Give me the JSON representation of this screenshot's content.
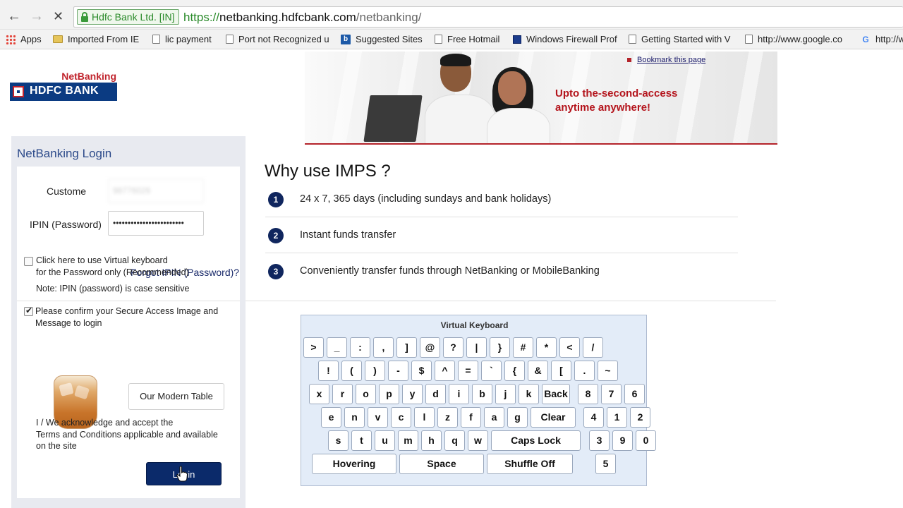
{
  "browser": {
    "ev_badge": "Hdfc Bank Ltd. [IN]",
    "url_scheme": "https://",
    "url_host": "netbanking.hdfcbank.com",
    "url_path": "/netbanking/",
    "back_icon": "←",
    "forward_icon": "→",
    "stop_icon": "✕"
  },
  "bookmarks": [
    {
      "label": "Apps",
      "icon": "apps-icon"
    },
    {
      "label": "Imported From IE",
      "icon": "folder-icon"
    },
    {
      "label": "lic payment",
      "icon": "page-icon"
    },
    {
      "label": "Port not Recognized u",
      "icon": "page-icon"
    },
    {
      "label": "Suggested Sites",
      "icon": "bing-icon"
    },
    {
      "label": "Free Hotmail",
      "icon": "page-icon"
    },
    {
      "label": "Windows Firewall Prof",
      "icon": "windows-icon"
    },
    {
      "label": "Getting Started with V",
      "icon": "page-icon"
    },
    {
      "label": "http://www.google.co",
      "icon": "page-icon"
    },
    {
      "label": "http://w",
      "icon": "google-icon"
    }
  ],
  "header": {
    "logo_top": "NetBanking",
    "logo_bank": "HDFC BANK",
    "banner_line1": "Upto the-second-access",
    "banner_line2": "anytime anywhere!",
    "bookmark_link": "Bookmark this page"
  },
  "login": {
    "title": "NetBanking Login",
    "customer_label": "Custome",
    "customer_value": "98776026",
    "ipin_label": "IPIN (Password)",
    "ipin_value": "••••••••••••••••••••••••",
    "forgot": "Forgot IPIN (Password)?",
    "vk_checkbox_line1": "Click here to use Virtual keyboard",
    "vk_checkbox_line2": "for the Password only (Recommended)",
    "note": "Note: IPIN (password) is case sensitive",
    "confirm_line1": "Please confirm your Secure Access Image and",
    "confirm_line2": "Message to login",
    "secure_message": "Our Modern Table",
    "terms_line1": "I / We acknowledge and accept the",
    "terms_line2": "Terms and Conditions applicable and available",
    "terms_line3": "on the site",
    "login_button": "Login"
  },
  "imps": {
    "title": "Why use IMPS ?",
    "items": [
      {
        "num": "1",
        "text": "24 x 7, 365 days (including sundays and bank holidays)"
      },
      {
        "num": "2",
        "text": "Instant funds transfer"
      },
      {
        "num": "3",
        "text": "Conveniently transfer funds through NetBanking or MobileBanking"
      }
    ]
  },
  "keyboard": {
    "title": "Virtual Keyboard",
    "row1": [
      ">",
      "_",
      ":",
      ",",
      "]",
      "@",
      "?",
      "|",
      "}",
      "#",
      "*",
      "<",
      "/"
    ],
    "row2": [
      "!",
      "(",
      ")",
      "-",
      "$",
      "^",
      "=",
      "`",
      "{",
      "&",
      "[",
      ".",
      "~"
    ],
    "row3": [
      "x",
      "r",
      "o",
      "p",
      "y",
      "d",
      "i",
      "b",
      "j",
      "k",
      "Back",
      "8",
      "7",
      "6"
    ],
    "row4": [
      "e",
      "n",
      "v",
      "c",
      "l",
      "z",
      "f",
      "a",
      "g",
      "Clear",
      "4",
      "1",
      "2"
    ],
    "row5": [
      "s",
      "t",
      "u",
      "m",
      "h",
      "q",
      "w",
      "Caps Lock",
      "3",
      "9",
      "0"
    ],
    "row6": [
      "Hovering",
      "Space",
      "Shuffle Off",
      "5"
    ]
  }
}
